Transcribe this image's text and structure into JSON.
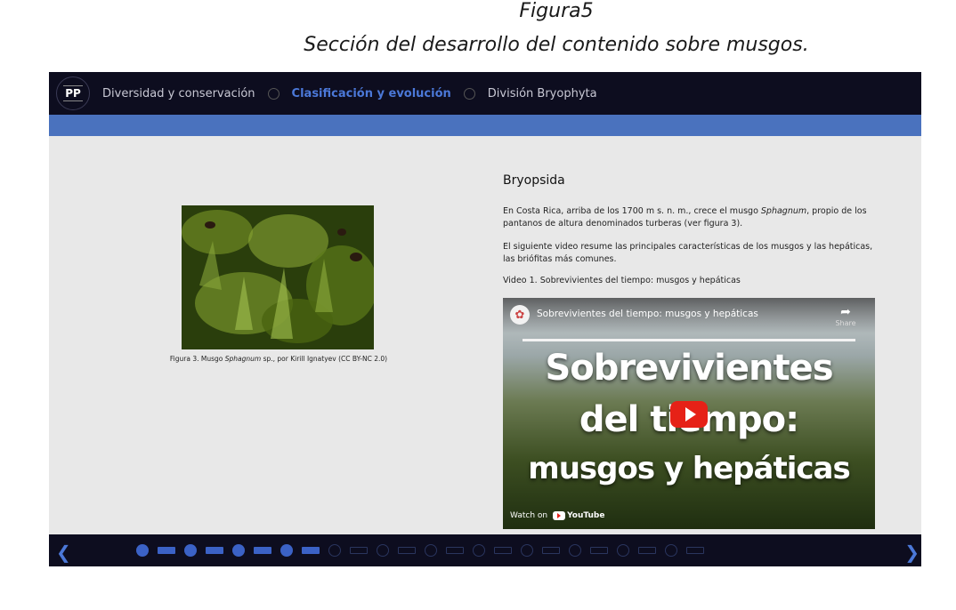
{
  "figure": {
    "number": "Figura5",
    "title": "Sección del desarrollo del contenido sobre musgos."
  },
  "app": {
    "logo": "PP",
    "nav": [
      {
        "label": "Diversidad y conservación",
        "active": false
      },
      {
        "label": "Clasificación y evolución",
        "active": true
      },
      {
        "label": "División Bryophyta",
        "active": false
      }
    ]
  },
  "left": {
    "photo_icon": "moss-photo",
    "caption_prefix": "Figura 3. Musgo ",
    "caption_species": "Sphagnum",
    "caption_suffix": " sp., por Kirill Ignatyev (CC BY-NC 2.0)"
  },
  "right": {
    "title": "Bryopsida",
    "p1_before": "En Costa Rica, arriba de los 1700 m s. n. m., crece el musgo ",
    "p1_species": "Sphagnum",
    "p1_after": ", propio de los pantanos de altura denominados turberas (ver figura 3).",
    "p2": "El siguiente video resume las principales características de los musgos y las hepáticas, las briófitas más comunes.",
    "p3": "Video 1. Sobrevivientes del tiempo: musgos y hepáticas"
  },
  "video": {
    "title": "Sobrevivientes del tiempo: musgos y hepáticas",
    "share_label": "Share",
    "big_line1": "Sobrevivientes",
    "big_line2": "del tiempo:",
    "big_line3": "musgos y hepáticas",
    "watch_on": "Watch on",
    "yt_label": "YouTube"
  },
  "pager": {
    "items": [
      {
        "shape": "dot",
        "state": "filled"
      },
      {
        "shape": "bar",
        "state": "filled"
      },
      {
        "shape": "dot",
        "state": "filled"
      },
      {
        "shape": "bar",
        "state": "filled"
      },
      {
        "shape": "dot",
        "state": "filled"
      },
      {
        "shape": "bar",
        "state": "filled"
      },
      {
        "shape": "dot",
        "state": "filled"
      },
      {
        "shape": "bar",
        "state": "filled"
      },
      {
        "shape": "dot",
        "state": "outline"
      },
      {
        "shape": "bar",
        "state": "outline"
      },
      {
        "shape": "dot",
        "state": "outline"
      },
      {
        "shape": "bar",
        "state": "outline"
      },
      {
        "shape": "dot",
        "state": "outline"
      },
      {
        "shape": "bar",
        "state": "outline"
      },
      {
        "shape": "dot",
        "state": "outline"
      },
      {
        "shape": "bar",
        "state": "outline"
      },
      {
        "shape": "dot",
        "state": "outline"
      },
      {
        "shape": "bar",
        "state": "outline"
      },
      {
        "shape": "dot",
        "state": "outline"
      },
      {
        "shape": "bar",
        "state": "outline"
      },
      {
        "shape": "dot",
        "state": "outline"
      },
      {
        "shape": "bar",
        "state": "outline"
      },
      {
        "shape": "dot",
        "state": "outline"
      },
      {
        "shape": "bar",
        "state": "outline"
      }
    ],
    "prev_icon": "chevron-left-icon",
    "next_icon": "chevron-right-icon"
  },
  "colors": {
    "accent": "#4b78d8",
    "band": "#4a72be",
    "bar_bg": "#0d0d1f",
    "content_bg": "#e8e8e8"
  }
}
